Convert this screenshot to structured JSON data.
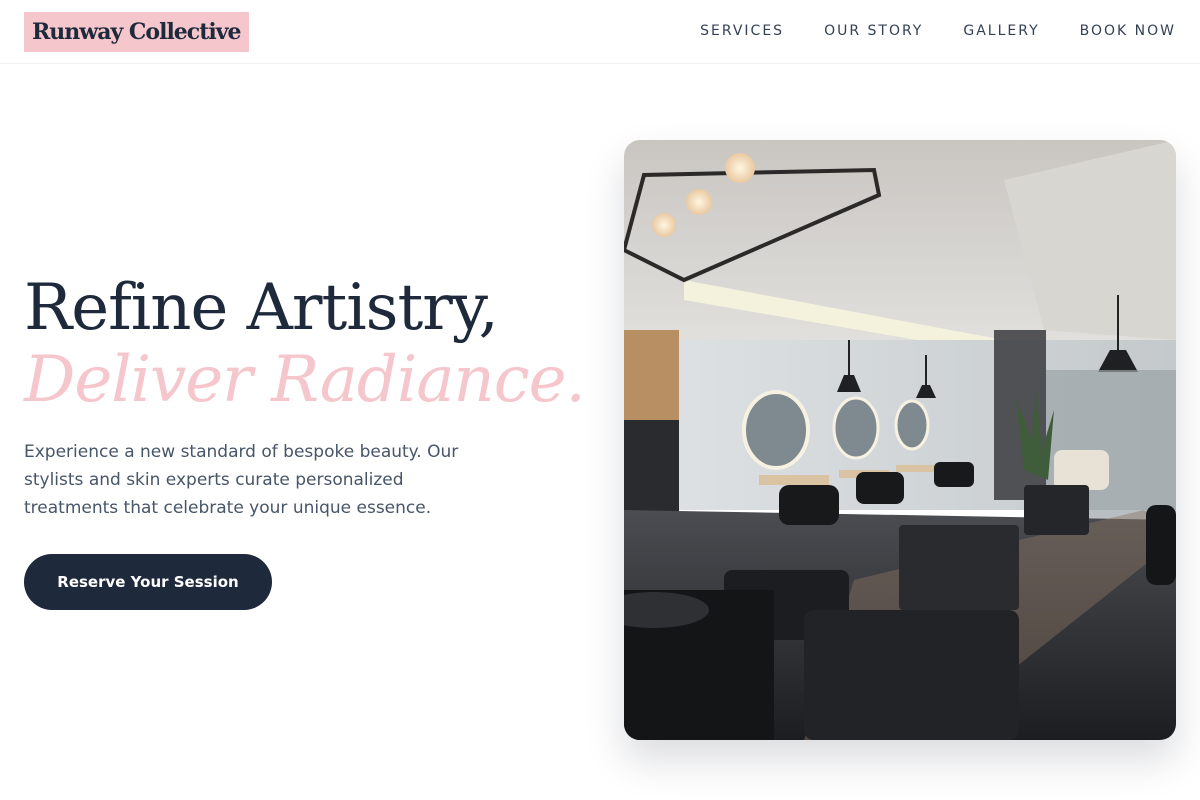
{
  "brand": {
    "name": "Runway Collective"
  },
  "nav": {
    "items": [
      "SERVICES",
      "OUR STORY",
      "GALLERY",
      "BOOK NOW"
    ]
  },
  "hero": {
    "headline_line1": "Refine Artistry,",
    "headline_line2": "Deliver Radiance.",
    "description": "Experience a new standard of bespoke beauty. Our stylists and skin experts curate personalized treatments that celebrate your unique essence.",
    "cta_label": "Reserve Your Session",
    "image_subject": "salon-interior-photo"
  },
  "colors": {
    "ink": "#1e293b",
    "accent_pink": "#f5c6cc",
    "body_text": "#475569"
  }
}
